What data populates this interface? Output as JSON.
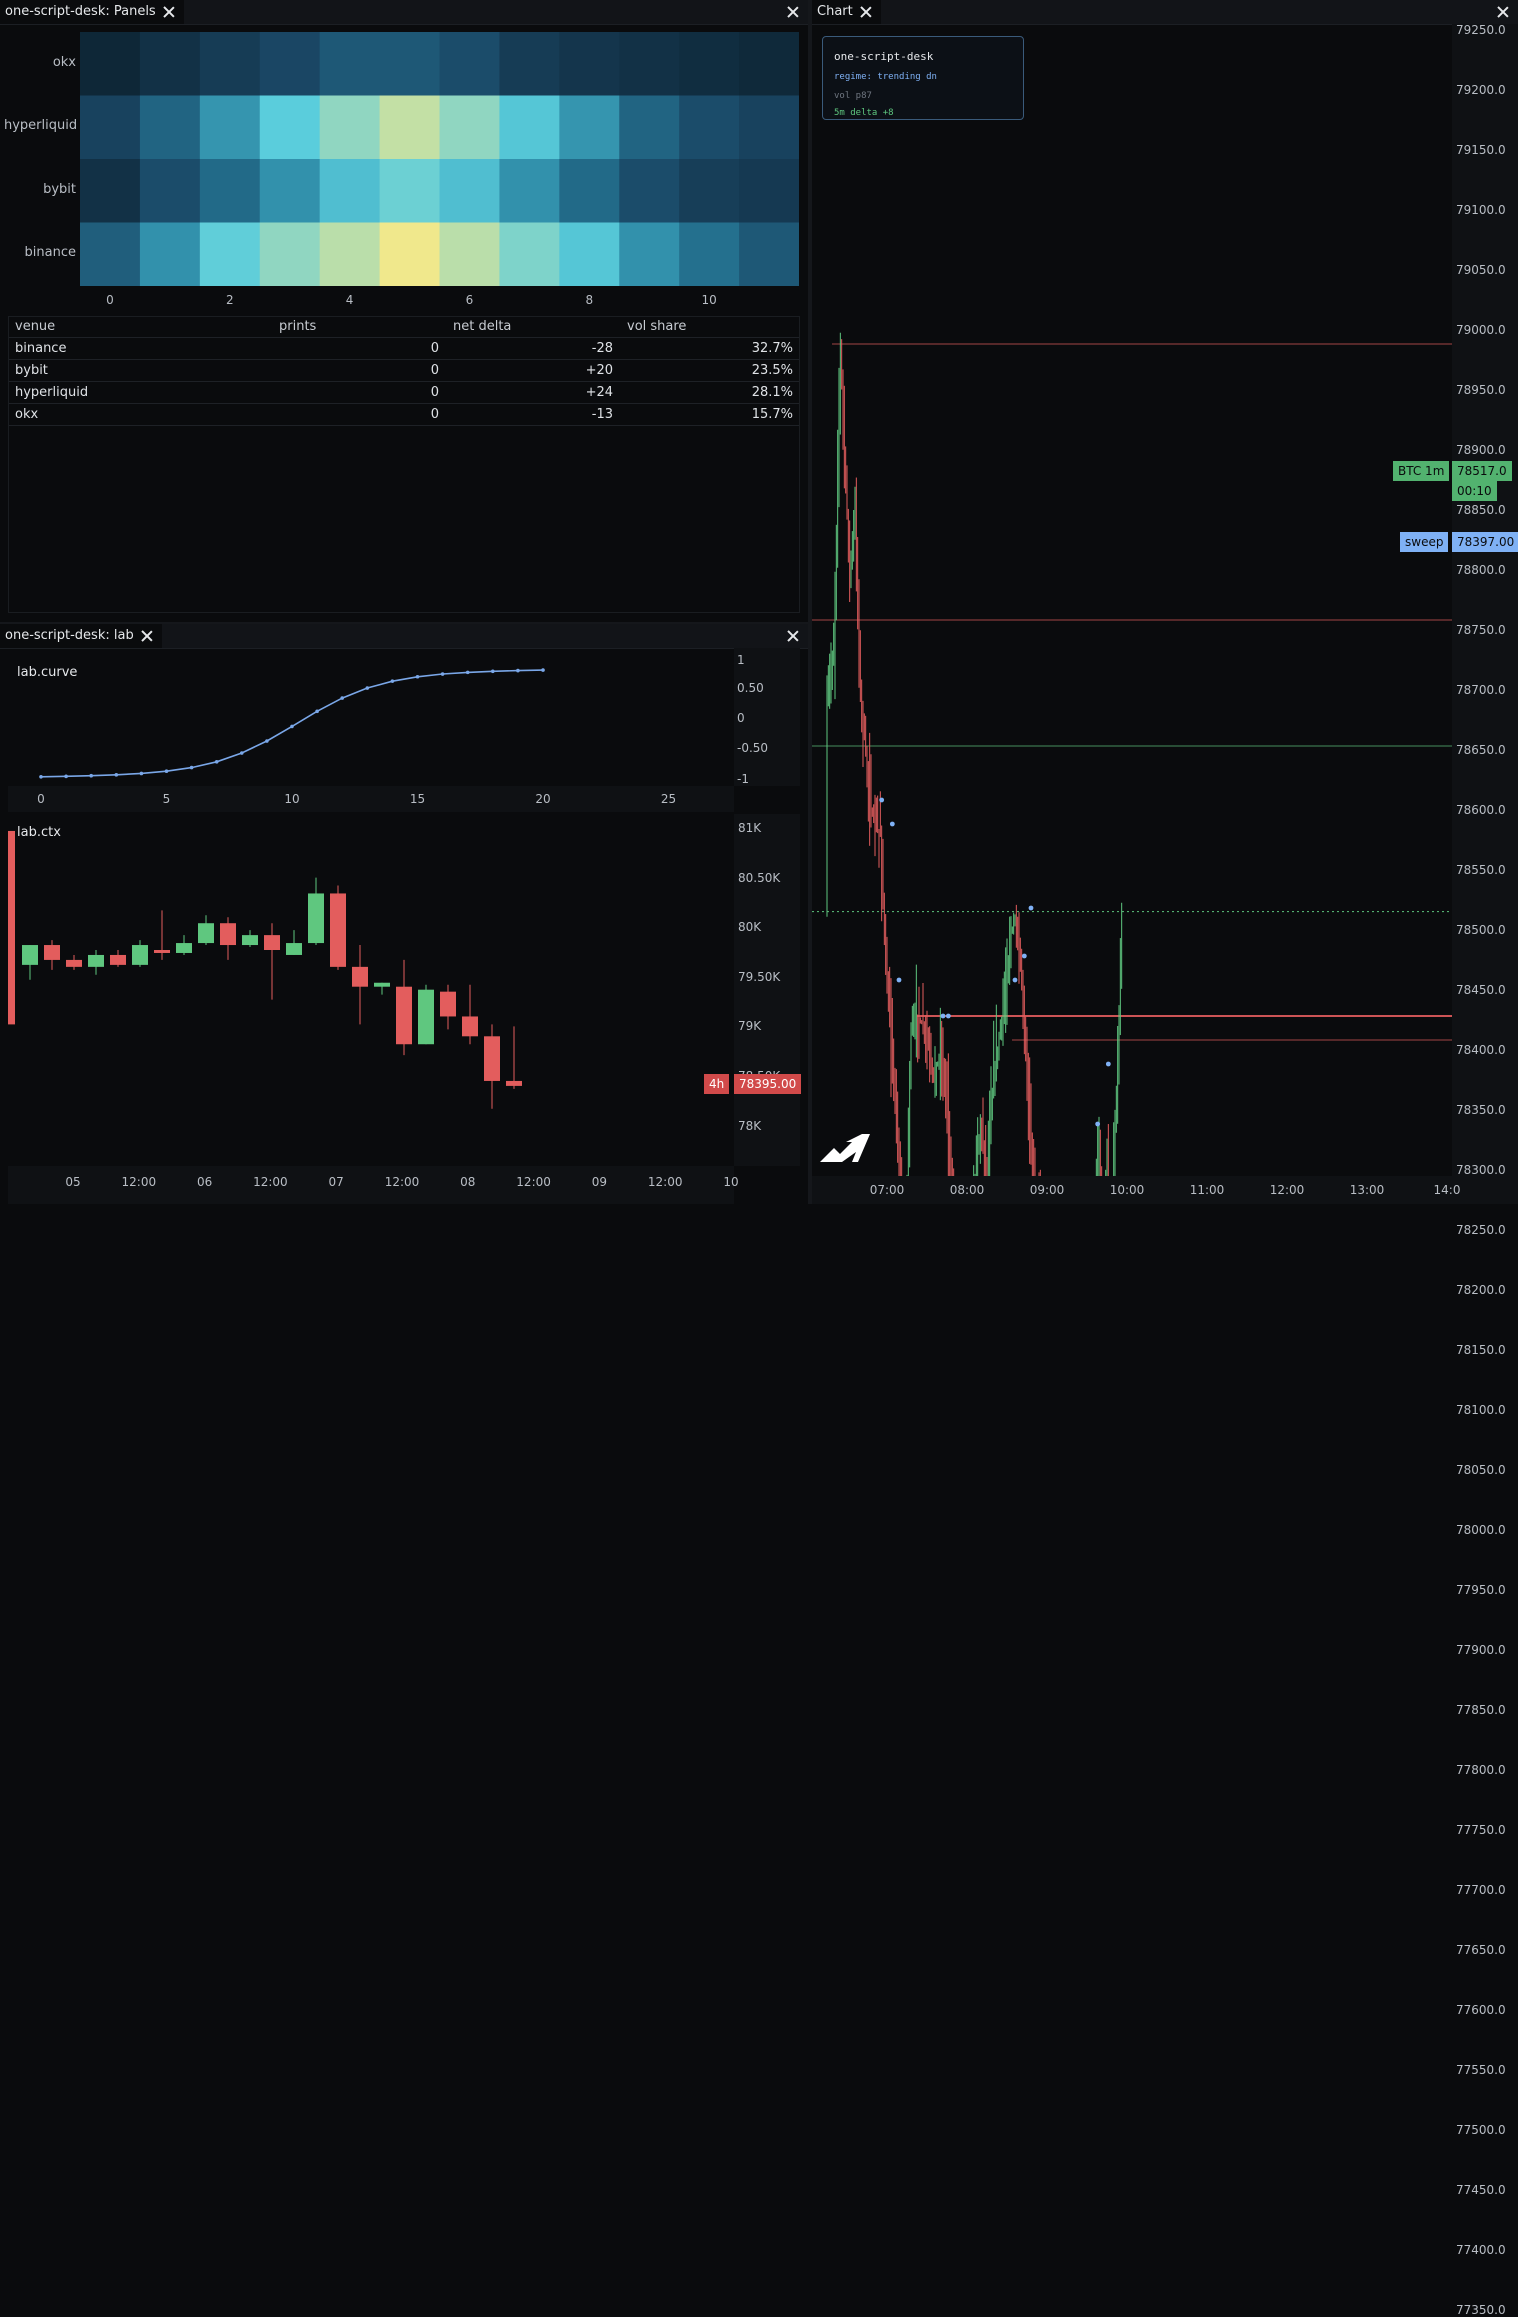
{
  "panels": {
    "tab_label": "one-script-desk: Panels",
    "heatmap": {
      "rows": [
        "okx",
        "hyperliquid",
        "bybit",
        "binance"
      ],
      "x_ticks": [
        "0",
        "2",
        "4",
        "6",
        "8",
        "10"
      ],
      "values": [
        [
          0.05,
          0.1,
          0.15,
          0.2,
          0.26,
          0.26,
          0.22,
          0.15,
          0.12,
          0.1,
          0.08,
          0.06
        ],
        [
          0.18,
          0.3,
          0.45,
          0.6,
          0.78,
          0.9,
          0.78,
          0.58,
          0.45,
          0.3,
          0.22,
          0.18
        ],
        [
          0.1,
          0.22,
          0.32,
          0.44,
          0.56,
          0.66,
          0.56,
          0.44,
          0.32,
          0.22,
          0.16,
          0.14
        ],
        [
          0.28,
          0.44,
          0.62,
          0.78,
          0.88,
          1.0,
          0.88,
          0.72,
          0.58,
          0.44,
          0.34,
          0.26
        ]
      ]
    },
    "table": {
      "headers": [
        "venue",
        "prints",
        "net delta",
        "vol share"
      ],
      "rows": [
        {
          "venue": "binance",
          "prints": "0",
          "delta": "-28",
          "share": "32.7%",
          "sign": "neg"
        },
        {
          "venue": "bybit",
          "prints": "0",
          "delta": "+20",
          "share": "23.5%",
          "sign": "pos"
        },
        {
          "venue": "hyperliquid",
          "prints": "0",
          "delta": "+24",
          "share": "28.1%",
          "sign": "pos"
        },
        {
          "venue": "okx",
          "prints": "0",
          "delta": "-13",
          "share": "15.7%",
          "sign": "neg"
        }
      ]
    }
  },
  "lab": {
    "tab_label": "one-script-desk: lab",
    "curve_title": "lab.curve",
    "ctx_title": "lab.ctx",
    "curve_y_ticks": [
      "1",
      "0.50",
      "0",
      "-0.50",
      "-1"
    ],
    "curve_x_ticks": [
      "0",
      "5",
      "10",
      "15",
      "20",
      "25"
    ],
    "ctx_y_ticks": [
      "81K",
      "80.50K",
      "80K",
      "79.50K",
      "79K",
      "78.50K",
      "78K"
    ],
    "ctx_x_ticks": [
      "05",
      "12:00",
      "06",
      "12:00",
      "07",
      "12:00",
      "08",
      "12:00",
      "09",
      "12:00",
      "10"
    ],
    "ctx_badge_tf": "4h",
    "ctx_badge_price": "78395.00"
  },
  "chart": {
    "tab_label": "Chart",
    "overlay": {
      "title": "one-script-desk",
      "regime": "regime: trending dn",
      "vol": "vol p87",
      "delta": "5m delta +8"
    },
    "y_ticks": [
      "79250.0",
      "79200.0",
      "79150.0",
      "79100.0",
      "79050.0",
      "79000.0",
      "78950.0",
      "78900.0",
      "78850.0",
      "78800.0",
      "78750.0",
      "78700.0",
      "78650.0",
      "78600.0",
      "78550.0",
      "78500.0",
      "78450.0",
      "78400.0",
      "78350.0",
      "78300.0",
      "78250.0",
      "78200.0",
      "78150.0",
      "78100.0",
      "78050.0",
      "78000.0",
      "77950.0",
      "77900.0",
      "77850.0",
      "77800.0",
      "77750.0",
      "77700.0",
      "77650.0",
      "77600.0",
      "77550.0",
      "77500.0",
      "77450.0",
      "77400.0",
      "77350.0"
    ],
    "x_ticks": [
      "07:00",
      "08:00",
      "09:00",
      "10:00",
      "11:00",
      "12:00",
      "13:00",
      "14:0"
    ],
    "last_label": "BTC 1m",
    "last_price": "78517.0",
    "countdown": "00:10",
    "sweep_label": "sweep",
    "sweep_price": "78397.00"
  },
  "colors": {
    "up": "#5fc77f",
    "down": "#e35d5d",
    "curve": "#7aa7e8",
    "badge_blue": "#7fb1f5"
  }
}
